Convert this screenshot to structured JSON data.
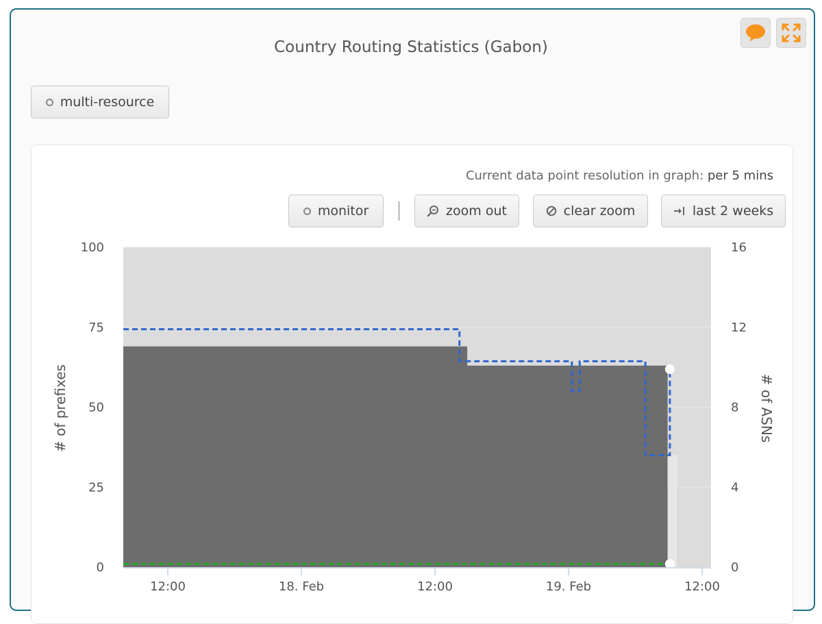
{
  "widget": {
    "title": "Country Routing Statistics (Gabon)",
    "multi_resource_label": "multi-resource",
    "resolution_prefix": "Current data point resolution in graph:",
    "resolution_value": "per 5 mins",
    "toolbar": {
      "monitor": "monitor",
      "zoom_out": "zoom out",
      "clear_zoom": "clear zoom",
      "last_2_weeks": "last 2 weeks"
    },
    "icons": {
      "feedback": "speech-bubble-icon",
      "fullscreen": "expand-icon",
      "zoom_out": "magnifier-icon",
      "clear_zoom": "cancel-circle-icon",
      "last_2_weeks": "arrow-to-bar-icon"
    },
    "colors": {
      "accent_orange": "#f7941d",
      "frame": "#1f6f86",
      "prefix_area": "#6d6d6d",
      "background_area": "#dcdcdc",
      "asn_line": "#3366cc",
      "green_line": "#22aa22"
    }
  },
  "chart_data": {
    "type": "area",
    "x_tick_labels": [
      "12:00",
      "18. Feb",
      "12:00",
      "19. Feb",
      "12:00"
    ],
    "x_ticks_hours": [
      12,
      24,
      36,
      48,
      60
    ],
    "x_range_hours": [
      8,
      60.8
    ],
    "ylabel_left": "# of prefixes",
    "ylabel_right": "# of ASNs",
    "ylim_left": [
      0,
      100
    ],
    "ylim_right": [
      0,
      16
    ],
    "yticks_left": [
      0,
      25,
      50,
      75,
      100
    ],
    "yticks_right": [
      0,
      4,
      8,
      12,
      16
    ],
    "grid": true,
    "series": [
      {
        "axis": "left",
        "style": "area-step",
        "x": [
          8,
          38.9,
          38.9,
          47.2,
          47.2,
          56.9,
          56.9,
          57.8
        ],
        "y": [
          69,
          69,
          63,
          63,
          63,
          63,
          25,
          25
        ]
      },
      {
        "axis": "left",
        "style": "area-step-light",
        "x": [
          56.9,
          57.8
        ],
        "y": [
          35,
          35
        ]
      },
      {
        "axis": "right",
        "style": "dashed-step",
        "x": [
          8,
          38.2,
          38.2,
          48.3,
          48.3,
          49.0,
          49.0,
          54.9,
          54.9,
          57.1,
          57.1
        ],
        "y": [
          11.9,
          11.9,
          10.3,
          10.3,
          8.8,
          8.8,
          10.3,
          10.3,
          5.6,
          5.6,
          9.9
        ]
      },
      {
        "axis": "left",
        "style": "dashed-line-green",
        "x": [
          8,
          57.1
        ],
        "y": [
          1,
          1
        ]
      }
    ]
  }
}
